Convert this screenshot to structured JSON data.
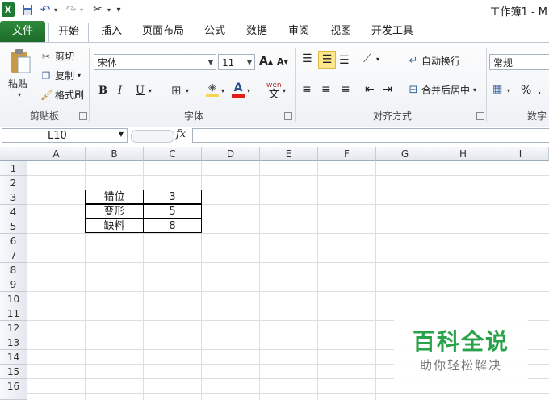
{
  "window": {
    "title": "工作簿1 - M"
  },
  "qat": {
    "customize": "▾"
  },
  "tabs": [
    {
      "label": "文件"
    },
    {
      "label": "开始"
    },
    {
      "label": "插入"
    },
    {
      "label": "页面布局"
    },
    {
      "label": "公式"
    },
    {
      "label": "数据"
    },
    {
      "label": "审阅"
    },
    {
      "label": "视图"
    },
    {
      "label": "开发工具"
    }
  ],
  "ribbon": {
    "clipboard": {
      "paste": "粘贴",
      "cut": "剪切",
      "copy": "复制",
      "format_painter": "格式刷",
      "label": "剪贴板"
    },
    "font": {
      "name": "宋体",
      "size": "11",
      "bold": "B",
      "italic": "I",
      "underline": "U",
      "label": "字体",
      "grow": "A",
      "shrink": "A",
      "phonetic": "wén",
      "phonetic2": "文"
    },
    "alignment": {
      "wrap": "自动换行",
      "merge": "合并后居中",
      "label": "对齐方式"
    },
    "number": {
      "format": "常规",
      "percent": "%",
      "label": "数字"
    }
  },
  "formula_bar": {
    "cell_ref": "L10",
    "fx": "fx",
    "value": ""
  },
  "sheet": {
    "columns": [
      "A",
      "B",
      "C",
      "D",
      "E",
      "F",
      "G",
      "H",
      "I"
    ],
    "rows": [
      "1",
      "2",
      "3",
      "4",
      "5",
      "6",
      "7",
      "8",
      "9",
      "10",
      "11",
      "12",
      "13",
      "14",
      "15",
      "16"
    ],
    "table": [
      {
        "label": "错位",
        "value": "3"
      },
      {
        "label": "变形",
        "value": "5"
      },
      {
        "label": "缺料",
        "value": "8"
      }
    ]
  },
  "watermark": {
    "title": "百科全说",
    "subtitle": "助你轻松解决"
  },
  "colors": {
    "file_tab": "#2f8a3a",
    "watermark": "#2aa24a",
    "highlight": "#f7d454",
    "font_red": "#e0201b"
  }
}
